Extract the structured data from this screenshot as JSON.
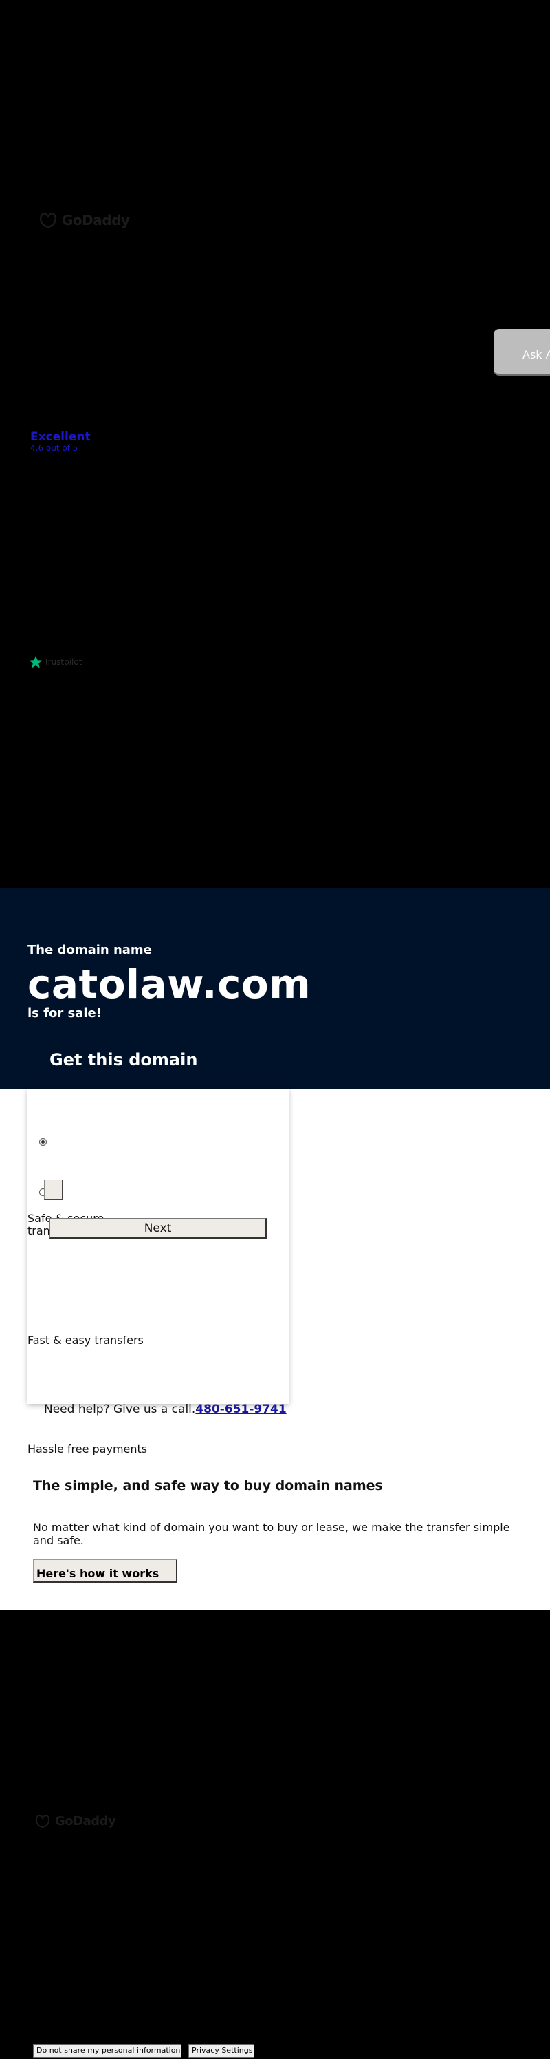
{
  "header": {
    "logo_text": "GoDaddy",
    "ask_button_label": "Ask A"
  },
  "rating": {
    "label": "Excellent",
    "score": "4.6 out of 5"
  },
  "trustpilot": {
    "label": "Trustpilot"
  },
  "hero": {
    "eyebrow": "The domain name",
    "domain": "catolaw.com",
    "for_sale": "is for sale!",
    "cta_title": "Get this domain"
  },
  "purchase_card": {
    "next_label": "Next"
  },
  "features": {
    "safe_line1": "Safe & secure",
    "safe_line2": "tran",
    "fast": "Fast & easy transfers",
    "hassle": "Hassle free payments"
  },
  "help": {
    "text": "Need help? Give us a call.",
    "phone": "480-651-9741"
  },
  "info": {
    "title": "The simple, and safe way to buy domain names",
    "description": "No matter what kind of domain you want to buy or lease, we make the transfer simple and safe.",
    "how_button": "Here's how it works"
  },
  "footer": {
    "logo_text": "GoDaddy",
    "privacy_opt_out": "Do not share my personal information",
    "privacy_settings": "Privacy Settings"
  },
  "colors": {
    "background": "#000000",
    "hero_bg": "#00112a",
    "link": "#1a18a0",
    "trustpilot_green": "#00b67a"
  }
}
